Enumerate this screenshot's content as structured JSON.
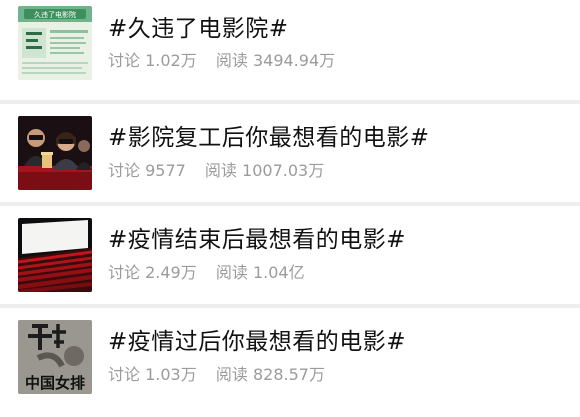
{
  "topics": [
    {
      "title": "#久违了电影院#",
      "discuss_label": "讨论",
      "discuss_value": "1.02万",
      "read_label": "阅读",
      "read_value": "3494.94万",
      "thumb_text": "久违了电影院"
    },
    {
      "title": "#影院复工后你最想看的电影#",
      "discuss_label": "讨论",
      "discuss_value": "9577",
      "read_label": "阅读",
      "read_value": "1007.03万"
    },
    {
      "title": "#疫情结束后最想看的电影#",
      "discuss_label": "讨论",
      "discuss_value": "2.49万",
      "read_label": "阅读",
      "read_value": "1.04亿"
    },
    {
      "title": "#疫情过后你最想看的电影#",
      "discuss_label": "讨论",
      "discuss_value": "1.03万",
      "read_label": "阅读",
      "read_value": "828.57万",
      "thumb_text": "中国女排"
    }
  ]
}
